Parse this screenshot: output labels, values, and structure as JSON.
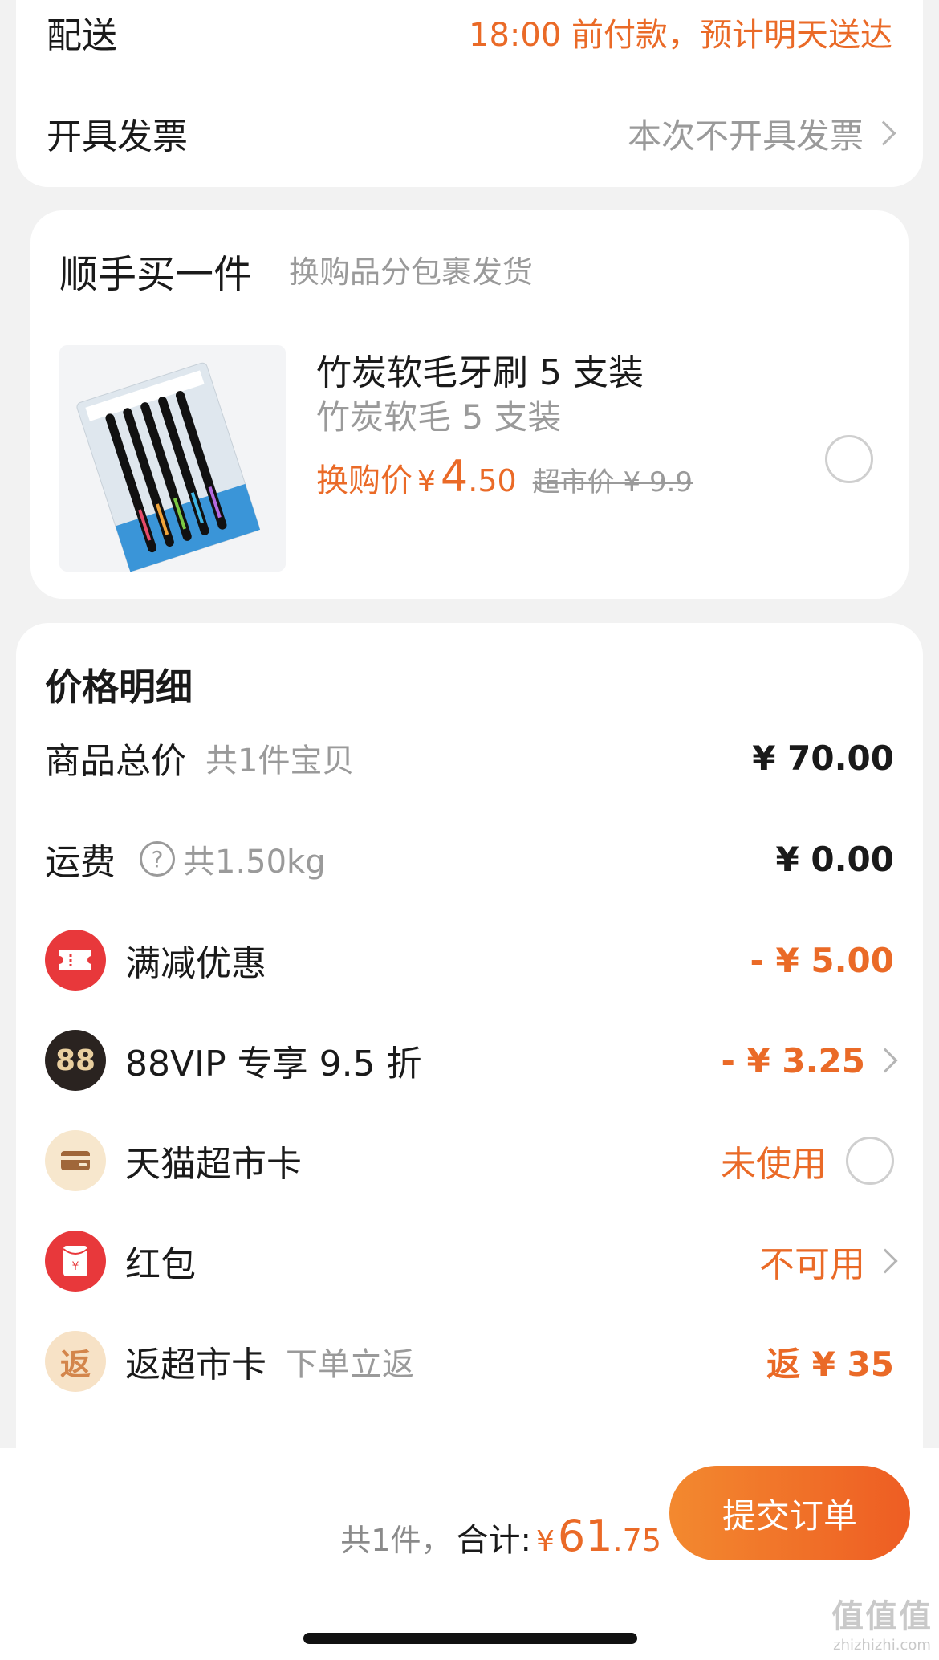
{
  "delivery": {
    "label": "配送",
    "value": "18:00 前付款，预计明天送达"
  },
  "invoice": {
    "label": "开具发票",
    "value": "本次不开具发票"
  },
  "addon": {
    "title": "顺手买一件",
    "subtitle": "换购品分包裹发货",
    "product": {
      "name": "竹炭软毛牙刷 5 支装",
      "spec": "竹炭软毛 5 支装",
      "swap_label": "换购价",
      "currency": "¥",
      "price_int": "4",
      "price_dec": ".50",
      "old_price": "超市价 ¥ 9.9",
      "selected": false
    }
  },
  "price_detail": {
    "title": "价格明细",
    "rows": [
      {
        "label": "商品总价",
        "sub": "共1件宝贝",
        "value": "¥ 70.00"
      },
      {
        "label": "运费",
        "sub": "共1.50kg",
        "value": "¥ 0.00"
      },
      {
        "label": "满减优惠",
        "value": "- ¥ 5.00",
        "icon": "coupon-icon",
        "color": "#e8383b"
      },
      {
        "label": "88VIP 专享 9.5 折",
        "value": "- ¥ 3.25",
        "icon_text": "88"
      },
      {
        "label": "天猫超市卡",
        "value": "未使用",
        "icon": "card-icon"
      },
      {
        "label": "红包",
        "value": "不可用",
        "icon": "red-packet-icon",
        "icon_text": "¥"
      },
      {
        "label": "返超市卡",
        "sub": "下单立返",
        "value": "返 ¥ 35",
        "icon_text": "返"
      }
    ]
  },
  "bottom": {
    "count": "共1件，",
    "total_label": "合计:",
    "currency": "¥",
    "total_int": "61",
    "total_dec": ".75",
    "submit": "提交订单"
  },
  "watermark": {
    "big": "值值值",
    "small": "zhizhizhi.com"
  },
  "colors": {
    "accent": "#ea6a27",
    "background": "#f2f2f2"
  }
}
